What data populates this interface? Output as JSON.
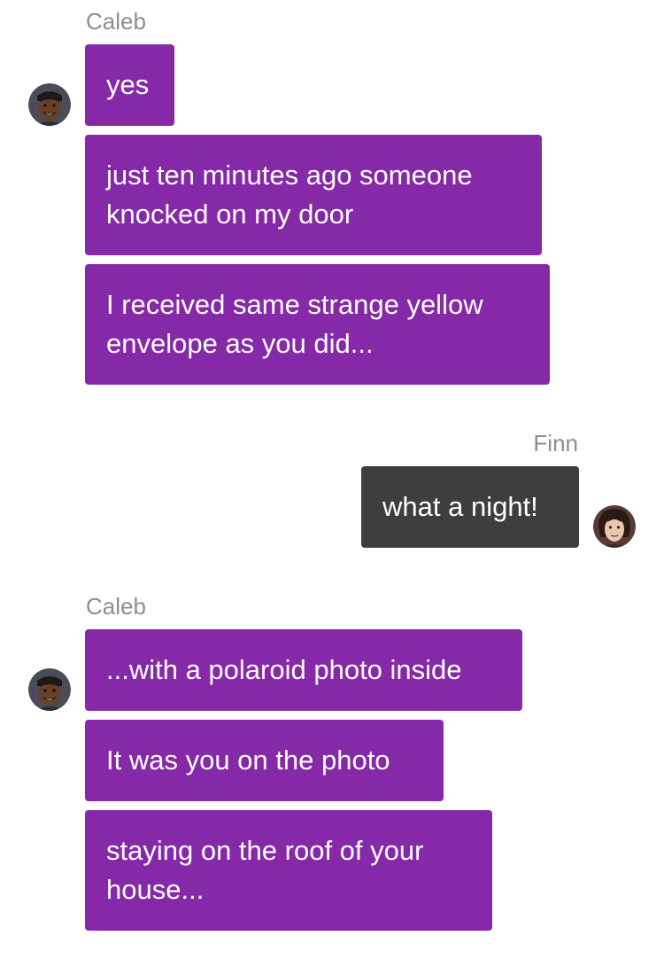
{
  "messages": [
    {
      "sender": "Caleb",
      "side": "left",
      "items": [
        "yes",
        "just ten minutes ago someone\nknocked on my door",
        "I received same strange yellow\nenvelope as you did..."
      ]
    },
    {
      "sender": "Finn",
      "side": "right",
      "items": [
        "what a night!"
      ]
    },
    {
      "sender": "Caleb",
      "side": "left",
      "items": [
        "...with a polaroid photo inside",
        "It was you on the photo",
        "staying on the roof of your\nhouse..."
      ]
    }
  ],
  "avatars": {
    "caleb": "caleb-avatar",
    "finn": "finn-avatar"
  },
  "colors": {
    "incoming_bubble": "#8629a8",
    "outgoing_bubble": "#3e3e3e",
    "sender_name": "#8e8e8e",
    "background": "#ffffff"
  }
}
